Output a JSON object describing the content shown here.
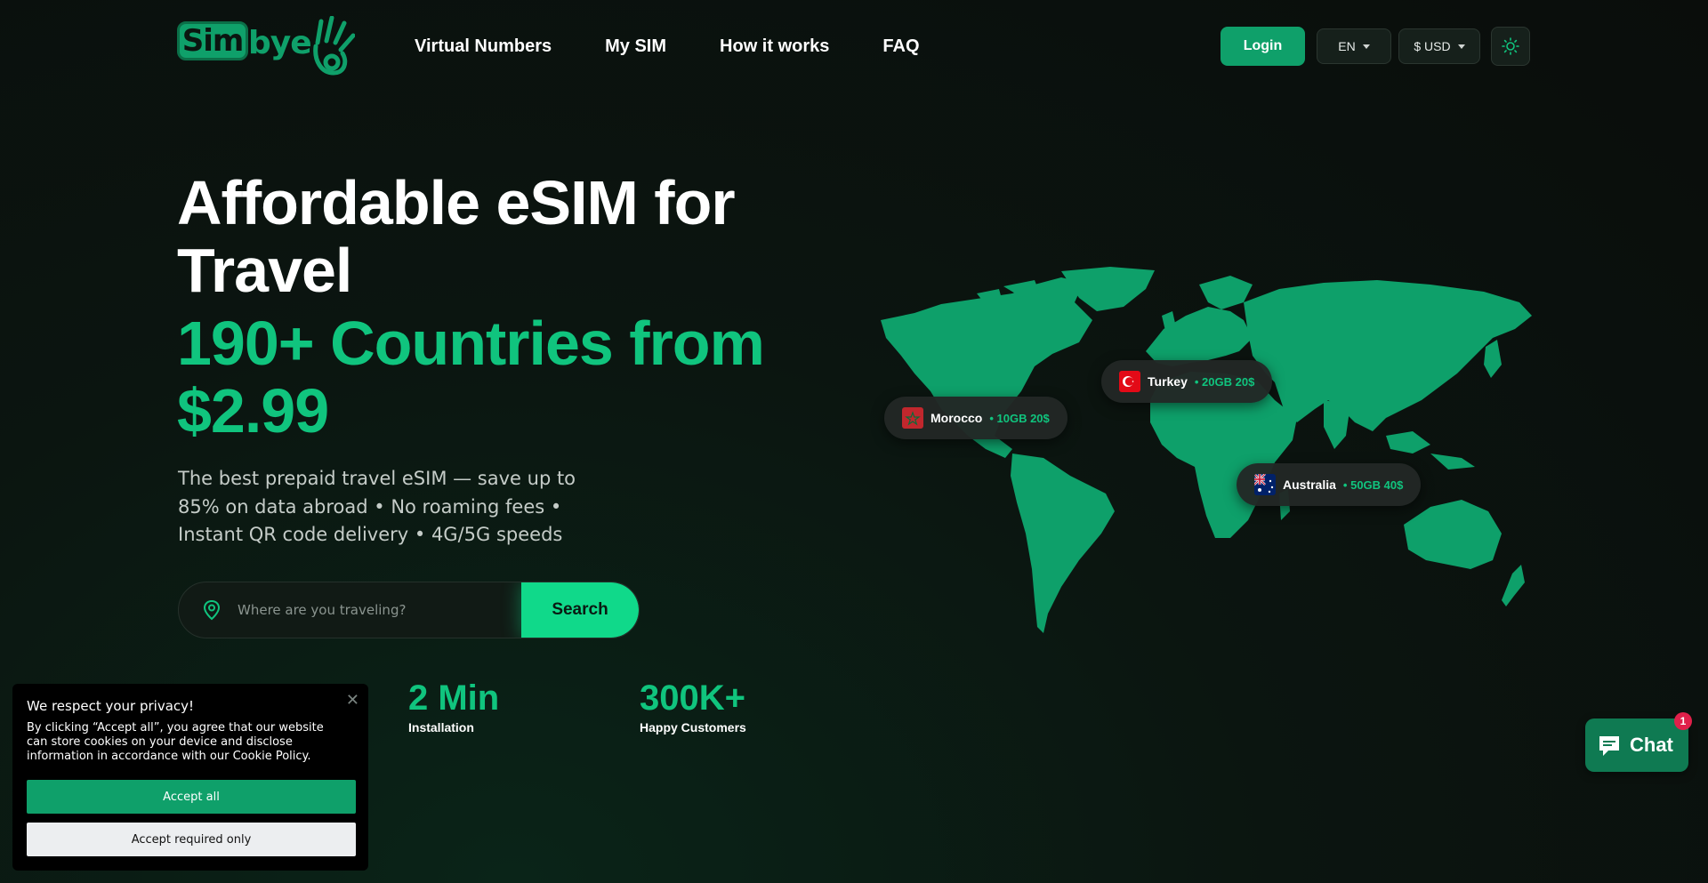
{
  "brand": {
    "logo_sim": "Sim",
    "logo_bye": "bye"
  },
  "nav": {
    "items": [
      {
        "label": "Virtual Numbers"
      },
      {
        "label": "My SIM"
      },
      {
        "label": "How it works"
      },
      {
        "label": "FAQ"
      }
    ]
  },
  "header": {
    "login_label": "Login",
    "language": "EN",
    "currency": "$ USD",
    "theme_icon": "sun-icon"
  },
  "hero": {
    "title": "Affordable eSIM for Travel",
    "highlight": "190+ Countries from $2.99",
    "subtitle": "The best prepaid travel eSIM — save up to 85% on data abroad • No roaming fees • Instant QR code delivery • 4G/5G speeds",
    "search_placeholder": "Where are you traveling?",
    "search_button": "Search"
  },
  "stats": [
    {
      "value": "2 Min",
      "label": "Installation"
    },
    {
      "value": "300K+",
      "label": "Happy Customers"
    }
  ],
  "map_pills": [
    {
      "country": "Morocco",
      "price": "• 10GB 20$",
      "flag": "morocco-flag"
    },
    {
      "country": "Turkey",
      "price": "• 20GB 20$",
      "flag": "turkey-flag"
    },
    {
      "country": "Australia",
      "price": "• 50GB 40$",
      "flag": "australia-flag"
    }
  ],
  "cookie": {
    "title": "We respect your privacy!",
    "text": "By clicking “Accept all”, you agree that our website can store cookies on your device and disclose information in accordance with our Cookie Policy.",
    "accept_all": "Accept all",
    "accept_required": "Accept required only",
    "close": "✕"
  },
  "chat": {
    "label": "Chat",
    "badge": "1"
  },
  "colors": {
    "accent": "#10c47e",
    "accent_dark": "#0fa06a",
    "background": "#0b1510",
    "badge": "#e0204a"
  }
}
